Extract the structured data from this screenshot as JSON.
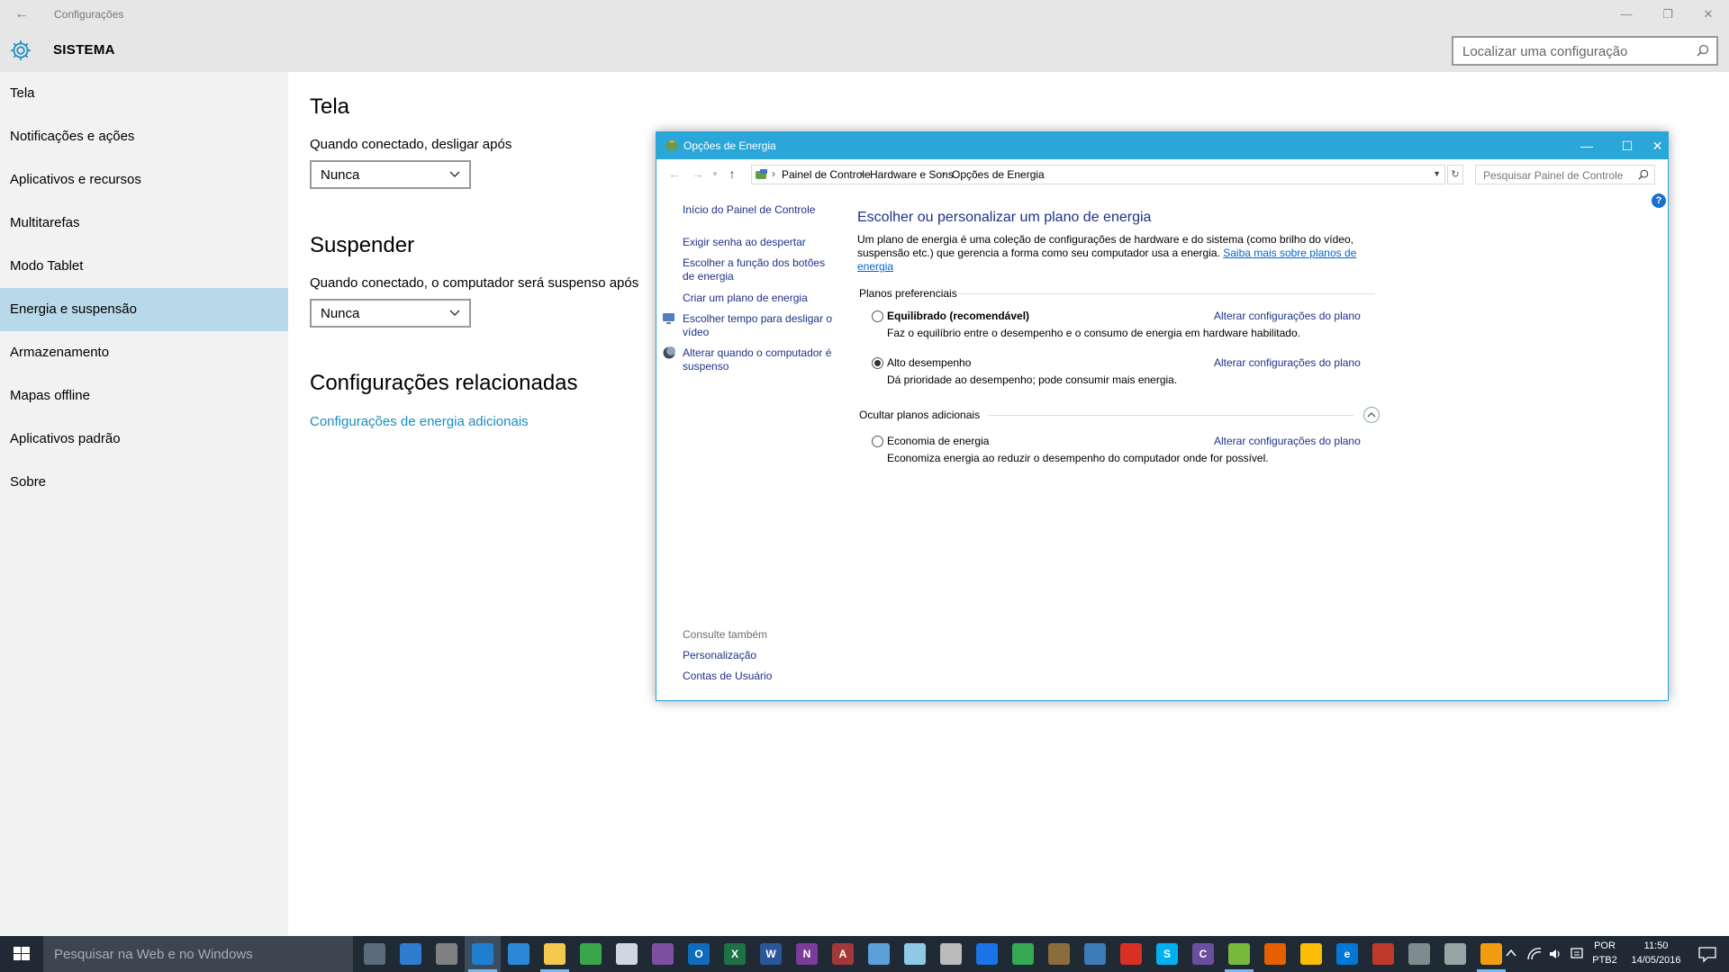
{
  "settings": {
    "app_title": "Configurações",
    "section": "SISTEMA",
    "search_placeholder": "Localizar uma configuração",
    "sidebar": [
      {
        "label": "Tela"
      },
      {
        "label": "Notificações e ações"
      },
      {
        "label": "Aplicativos e recursos"
      },
      {
        "label": "Multitarefas"
      },
      {
        "label": "Modo Tablet"
      },
      {
        "label": "Energia e suspensão"
      },
      {
        "label": "Armazenamento"
      },
      {
        "label": "Mapas offline"
      },
      {
        "label": "Aplicativos padrão"
      },
      {
        "label": "Sobre"
      }
    ],
    "active_item": "Energia e suspensão",
    "screen_heading": "Tela",
    "screen_label": "Quando conectado, desligar após",
    "screen_value": "Nunca",
    "sleep_heading": "Suspender",
    "sleep_label": "Quando conectado, o computador será suspenso após",
    "sleep_value": "Nunca",
    "related_heading": "Configurações relacionadas",
    "related_link": "Configurações de energia adicionais"
  },
  "power_window": {
    "title": "Opções de Energia",
    "breadcrumb": [
      "Painel de Controle",
      "Hardware e Sons",
      "Opções de Energia"
    ],
    "search_placeholder": "Pesquisar Painel de Controle",
    "left_links": [
      "Início do Painel de Controle",
      "Exigir senha ao despertar",
      "Escolher a função dos botões de energia",
      "Criar um plano de energia",
      "Escolher tempo para desligar o vídeo",
      "Alterar quando o computador é suspenso"
    ],
    "see_also_label": "Consulte também",
    "see_also": [
      "Personalização",
      "Contas de Usuário"
    ],
    "heading": "Escolher ou personalizar um plano de energia",
    "description": "Um plano de energia é uma coleção de configurações de hardware e do sistema (como brilho do vídeo, suspensão etc.) que gerencia a forma como seu computador usa a energia.",
    "description_link": "Saiba mais sobre planos de energia",
    "preferred_label": "Planos preferenciais",
    "hidden_label": "Ocultar planos adicionais",
    "change_link": "Alterar configurações do plano",
    "plans": [
      {
        "name": "Equilibrado (recomendável)",
        "desc": "Faz o equilíbrio entre o desempenho e o consumo de energia em hardware habilitado.",
        "selected": false
      },
      {
        "name": "Alto desempenho",
        "desc": "Dá prioridade ao desempenho; pode consumir mais energia.",
        "selected": true
      },
      {
        "name": "Economia de energia",
        "desc": "Economiza energia ao reduzir o desempenho do computador onde for possível.",
        "selected": false
      }
    ],
    "help": "?"
  },
  "taskbar": {
    "search_placeholder": "Pesquisar na Web e no Windows",
    "apps": [
      {
        "icon": "task-view-icon"
      },
      {
        "icon": "store-icon"
      },
      {
        "icon": "settings-icon"
      },
      {
        "icon": "control-panel-icon"
      },
      {
        "icon": "remote-desktop-icon"
      },
      {
        "icon": "file-explorer-icon"
      },
      {
        "icon": "xbox-icon"
      },
      {
        "icon": "airplane-icon"
      },
      {
        "icon": "onenote-icon"
      },
      {
        "icon": "outlook-icon",
        "glyph": "O"
      },
      {
        "icon": "excel-icon",
        "glyph": "X"
      },
      {
        "icon": "word-icon",
        "glyph": "W"
      },
      {
        "icon": "onenote-2016-icon",
        "glyph": "N"
      },
      {
        "icon": "access-icon",
        "glyph": "A"
      },
      {
        "icon": "paint-icon"
      },
      {
        "icon": "notepad-icon"
      },
      {
        "icon": "calculator-icon"
      },
      {
        "icon": "onedrive-icon"
      },
      {
        "icon": "google-drive-icon"
      },
      {
        "icon": "library-icon"
      },
      {
        "icon": "network-icon"
      },
      {
        "icon": "nero-icon"
      },
      {
        "icon": "skype-icon",
        "glyph": "S"
      },
      {
        "icon": "ccleaner-icon",
        "glyph": "C"
      },
      {
        "icon": "utorrent-icon"
      },
      {
        "icon": "firefox-icon"
      },
      {
        "icon": "chrome-icon"
      },
      {
        "icon": "edge-icon",
        "glyph": "e"
      },
      {
        "icon": "game-icon"
      },
      {
        "icon": "warships-icon"
      },
      {
        "icon": "tools-icon"
      },
      {
        "icon": "media-icon"
      }
    ],
    "lang_top": "POR",
    "lang_bottom": "PTB2",
    "time": "11:50",
    "date": "14/05/2016"
  },
  "colors": {
    "accent": "#2aa7d8",
    "active_sidebar": "#b7d9ea",
    "link_blue": "#1a8dbf",
    "taskbar": "#1f2a34"
  }
}
